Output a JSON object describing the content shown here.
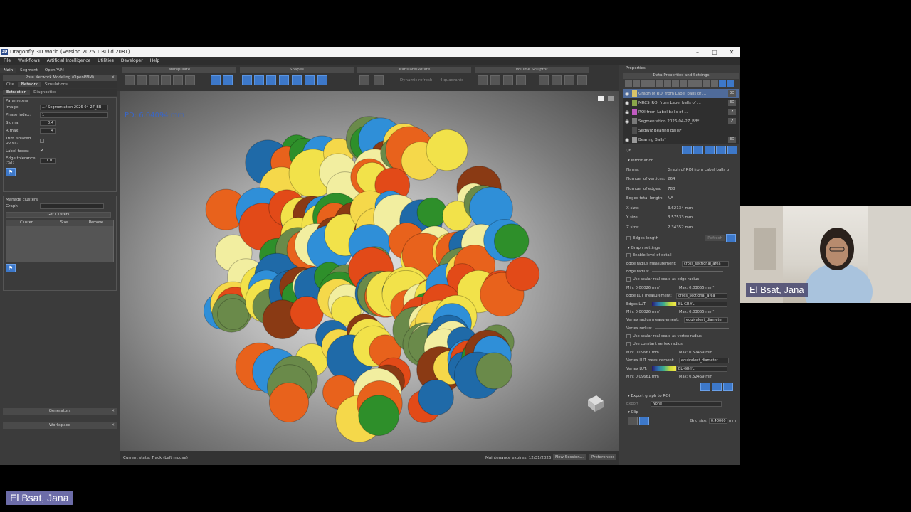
{
  "window": {
    "title": "Dragonfly 3D World (Version 2025.1 Build 2081)",
    "logo": "3D",
    "minimize": "–",
    "maximize": "▢",
    "close": "✕"
  },
  "menu": [
    "File",
    "Workflows",
    "Artificial Intelligence",
    "Utilities",
    "Developer",
    "Help"
  ],
  "left_tabs": [
    "Main",
    "Segment",
    "OpenPNM"
  ],
  "toolbar": {
    "groups": [
      "Manipulate",
      "Shapes",
      "Translate/Rotate",
      "Volume Sculptor"
    ],
    "dynamic_refresh": "Dynamic refresh",
    "quadrants": "4 quadrants"
  },
  "pnm_panel": {
    "title": "Pore Network Modeling (OpenPNM)",
    "tabs": [
      "Cite",
      "Network",
      "Simulations"
    ],
    "subtabs": [
      "Extraction",
      "Diagnostics"
    ],
    "parameters_label": "Parameters",
    "image_label": "Image:",
    "image_value": "...f Segmentation 2026-04-27_BB",
    "phase_label": "Phase index:",
    "phase_value": "1",
    "sigma_label": "Sigma:",
    "sigma_value": "0.4",
    "rmax_label": "R max:",
    "rmax_value": "4",
    "trim_label": "Trim isolated pores:",
    "label_faces_label": "Label faces:",
    "label_faces_check": "✔",
    "edge_tol_label": "Edge tolerance (%):",
    "edge_tol_value": "0.10"
  },
  "clusters": {
    "title": "Manage clusters",
    "graph_label": "Graph",
    "get_clusters": "Get Clusters",
    "columns": [
      "Cluster",
      "Size",
      "Remove"
    ]
  },
  "collapsed_panels": [
    "Generators",
    "Workspace"
  ],
  "viewport": {
    "pd_label": "PD: 6.04094 mm"
  },
  "statusbar": {
    "current_state": "Current state: Track (Left mouse)",
    "maintenance": "Maintenance expires: 12/31/2026",
    "new_session": "New Session...",
    "preferences": "Preferences"
  },
  "properties": {
    "title": "Properties",
    "dps_title": "Data Properties and Settings",
    "items": [
      {
        "label": "Graph of ROI from Label balls of ...",
        "tag": "3D",
        "color": "#d8c36a"
      },
      {
        "label": "MRCS_ROI from Label balls of ...",
        "tag": "3D",
        "color": "#8aa64a"
      },
      {
        "label": "ROI from Label balls of ...",
        "tag": "↗",
        "color": "#c05ac0"
      },
      {
        "label": "Segmentation 2026-04-27_BB*",
        "tag": "↗",
        "color": "#7a7a7a"
      },
      {
        "label": "SegWiz Bearing Balls*",
        "tag": "",
        "color": "#4f4f4f"
      },
      {
        "label": "Bearing Balls*",
        "tag": "3D",
        "color": "#9a9a9a"
      }
    ],
    "count": "1/6"
  },
  "information": {
    "title": "Information",
    "rows": [
      {
        "k": "Name:",
        "v": "Graph of ROI from Label balls o"
      },
      {
        "k": "Number of vertices:",
        "v": "264"
      },
      {
        "k": "Number of edges:",
        "v": "788"
      },
      {
        "k": "Edges total length:",
        "v": "NA"
      },
      {
        "k": "X size:",
        "v": "3.62134 mm"
      },
      {
        "k": "Y size:",
        "v": "3.57533 mm"
      },
      {
        "k": "Z size:",
        "v": "2.34352 mm"
      }
    ],
    "edges_length": "Edges length",
    "refresh": "Refresh"
  },
  "graph_settings": {
    "title": "Graph settings",
    "enable_lod": "Enable level of detail",
    "edge_radius_measurement": "Edge radius measurement:",
    "edge_radius_measurement_value": "cross_sectional_area",
    "edge_radius": "Edge radius:",
    "use_scalar_edge": "Use scalar real scale as edge radius",
    "edge_min": "Min: 0.00026 mm²",
    "edge_max": "Max: 0.03055 mm²",
    "edge_lut_measurement": "Edge LUT measurement:",
    "edge_lut_measurement_value": "cross_sectional_area",
    "edges_lut": "Edges LUT:",
    "edges_lut_value": "BL-GR-YL",
    "edge_lut_min": "Min: 0.00026 mm²",
    "edge_lut_max": "Max: 0.03055 mm²",
    "vertex_radius_measurement": "Vertex radius measurement:",
    "vertex_radius_measurement_value": "equivalent_diameter",
    "vertex_radius": "Vertex radius:",
    "use_scalar_vertex": "Use scalar real scale as vertex radius",
    "use_constant_vertex": "Use constant vertex radius",
    "vertex_min": "Min: 0.09661 mm",
    "vertex_max": "Max: 0.52469 mm",
    "vertex_lut_measurement": "Vertex LUT measurement:",
    "vertex_lut_measurement_value": "equivalent_diameter",
    "vertex_lut": "Vertex LUT:",
    "vertex_lut_value": "BL-GR-YL",
    "vertex_lut_min": "Min: 0.09661 mm",
    "vertex_lut_max": "Max: 0.52469 mm"
  },
  "export": {
    "title": "Export graph to ROI",
    "export_label": "Export",
    "export_value": "None"
  },
  "clip": {
    "title": "Clip",
    "grid_size_label": "Grid size:",
    "grid_size_value": "0.40000",
    "grid_size_unit": "mm"
  },
  "participant_name": "El Bsat, Jana",
  "colors": {
    "accent": "#3d78c9",
    "viewport_label": "#3b66c4",
    "balls": [
      "#e8621c",
      "#f2e24a",
      "#2f8fd8",
      "#2e8f2a",
      "#8a3a14",
      "#f2eea0",
      "#1f6aa8",
      "#6a8a4a",
      "#f5d84a",
      "#e24a18"
    ]
  }
}
